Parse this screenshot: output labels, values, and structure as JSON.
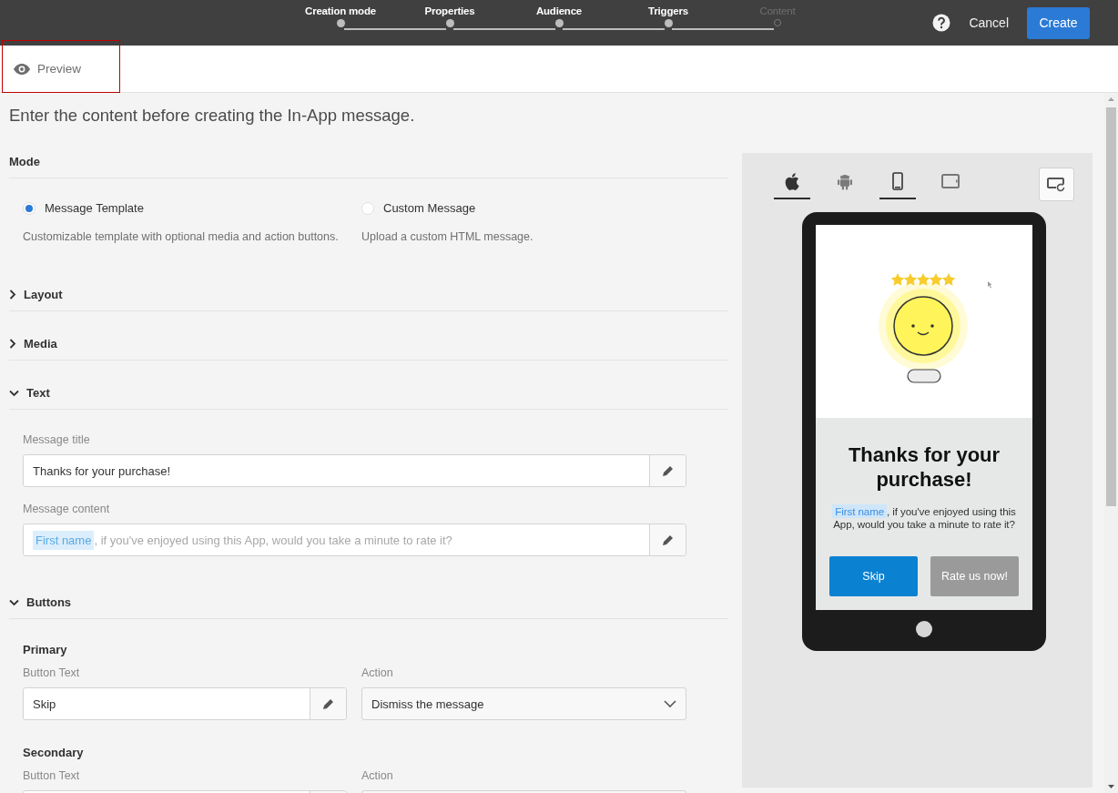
{
  "steps": [
    {
      "label": "Creation mode",
      "completed": true
    },
    {
      "label": "Properties",
      "completed": true
    },
    {
      "label": "Audience",
      "completed": true
    },
    {
      "label": "Triggers",
      "completed": true
    },
    {
      "label": "Content",
      "completed": false
    }
  ],
  "actions": {
    "cancel": "Cancel",
    "create": "Create"
  },
  "preview_tab": {
    "label": "Preview",
    "highlighted": true
  },
  "heading": "Enter the content before creating the In-App message.",
  "mode": {
    "title": "Mode",
    "options": [
      {
        "label": "Message Template",
        "description": "Customizable template with optional media and action buttons.",
        "selected": true
      },
      {
        "label": "Custom Message",
        "description": "Upload a custom HTML message.",
        "selected": false
      }
    ]
  },
  "sections": [
    {
      "title": "Layout",
      "expanded": false
    },
    {
      "title": "Media",
      "expanded": false
    },
    {
      "title": "Text",
      "expanded": true
    },
    {
      "title": "Buttons",
      "expanded": true
    }
  ],
  "text_fields": [
    {
      "label": "Message title",
      "value": "Thanks for your purchase!"
    },
    {
      "label": "Message content",
      "token": "First name",
      "value": ", if you've enjoyed using this App, would you take a minute to rate it?"
    }
  ],
  "buttons_groups": [
    {
      "title": "Primary",
      "text_label": "Button Text",
      "value": "Skip",
      "action_label": "Action",
      "action": "Dismiss the message"
    },
    {
      "title": "Secondary",
      "text_label": "Button Text",
      "action_label": "Action"
    }
  ],
  "preview": {
    "platforms": [
      {
        "kind": "apple",
        "selected": true
      },
      {
        "kind": "android",
        "selected": false
      }
    ],
    "devices": [
      {
        "kind": "phone",
        "selected": true
      },
      {
        "kind": "tablet",
        "selected": false
      }
    ],
    "title": "Thanks for your purchase!",
    "token": "First name",
    "body": ", if you've enjoyed using this App, would you take a minute to rate it?",
    "buttons": [
      {
        "label": "Skip",
        "kind": "primary"
      },
      {
        "label": "Rate us now!",
        "kind": "secondary"
      }
    ]
  }
}
